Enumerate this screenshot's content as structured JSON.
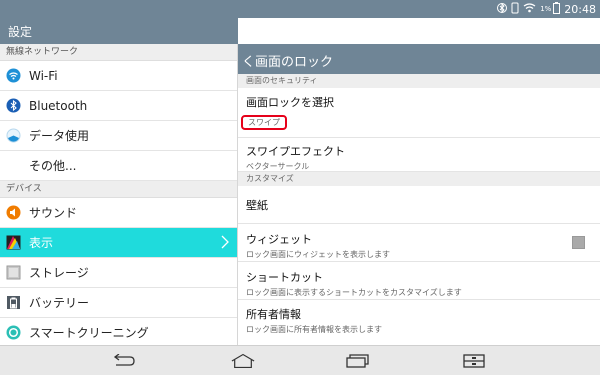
{
  "status": {
    "battery_percent": "1%",
    "time": "20:48",
    "icons": [
      "bluetooth-icon",
      "phone-icon",
      "wifi-icon",
      "battery-icon"
    ]
  },
  "app": {
    "title": "設定"
  },
  "sidebar": {
    "sections": [
      {
        "header": "無線ネットワーク",
        "items": [
          {
            "label": "Wi-Fi",
            "icon": "wifi-icon"
          },
          {
            "label": "Bluetooth",
            "icon": "bluetooth-icon"
          },
          {
            "label": "データ使用",
            "icon": "data-usage-icon"
          },
          {
            "label": "その他..."
          }
        ]
      },
      {
        "header": "デバイス",
        "items": [
          {
            "label": "サウンド",
            "icon": "sound-icon"
          },
          {
            "label": "表示",
            "icon": "display-icon",
            "active": true
          },
          {
            "label": "ストレージ",
            "icon": "storage-icon"
          },
          {
            "label": "バッテリー",
            "icon": "battery-icon"
          },
          {
            "label": "スマートクリーニング",
            "icon": "smart-cleaning-icon"
          }
        ]
      }
    ]
  },
  "detail": {
    "title": "く画面のロック",
    "sections": [
      {
        "header": "画面のセキュリティ",
        "items": [
          {
            "title": "画面ロックを選択",
            "subtitle": "スワイプ"
          },
          {
            "title": "スワイプエフェクト",
            "subtitle": "ベクターサークル"
          }
        ]
      },
      {
        "header": "カスタマイズ",
        "items": [
          {
            "title": "壁紙"
          },
          {
            "title": "ウィジェット",
            "subtitle": "ロック画面にウィジェットを表示します",
            "checkbox": true
          },
          {
            "title": "ショートカット",
            "subtitle": "ロック画面に表示するショートカットをカスタマイズします"
          },
          {
            "title": "所有者情報",
            "subtitle": "ロック画面に所有者情報を表示します"
          }
        ]
      }
    ]
  },
  "colors": {
    "header": "#6f8596",
    "accent": "#1fdbdc",
    "highlight": "#e6001a"
  },
  "navbar": {
    "buttons": [
      "back-icon",
      "home-icon",
      "recent-apps-icon",
      "menu-icon"
    ]
  }
}
